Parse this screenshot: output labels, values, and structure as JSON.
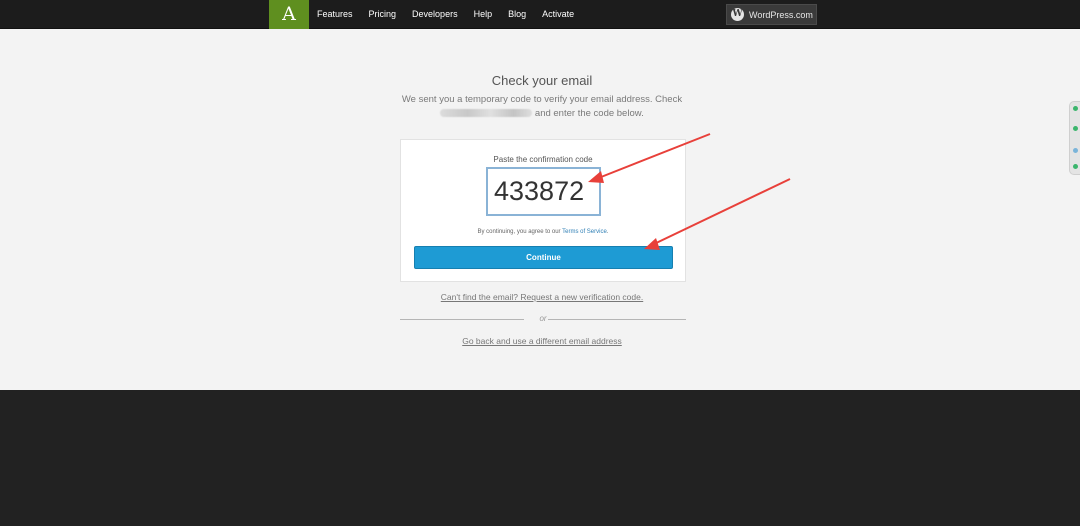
{
  "nav": {
    "logo": "A",
    "items": [
      "Features",
      "Pricing",
      "Developers",
      "Help",
      "Blog",
      "Activate"
    ],
    "wordpress_label": "WordPress.com"
  },
  "verify": {
    "title": "Check your email",
    "subtitle_pre": "We sent you a temporary code to verify your email address. Check",
    "subtitle_post": "and enter the code below.",
    "code_label": "Paste the confirmation code",
    "code_value": "433872",
    "tos_pre": "By continuing, you agree to our",
    "tos_link": "Terms of Service",
    "tos_post": ".",
    "continue_label": "Continue",
    "resend_link": "Can't find the email? Request a new verification code.",
    "or_text": "or",
    "goback_link": "Go back and use a different email address"
  },
  "colors": {
    "logo_bg": "#5f8f1f",
    "button_bg": "#1e9bd4",
    "arrow": "#e8403a"
  }
}
